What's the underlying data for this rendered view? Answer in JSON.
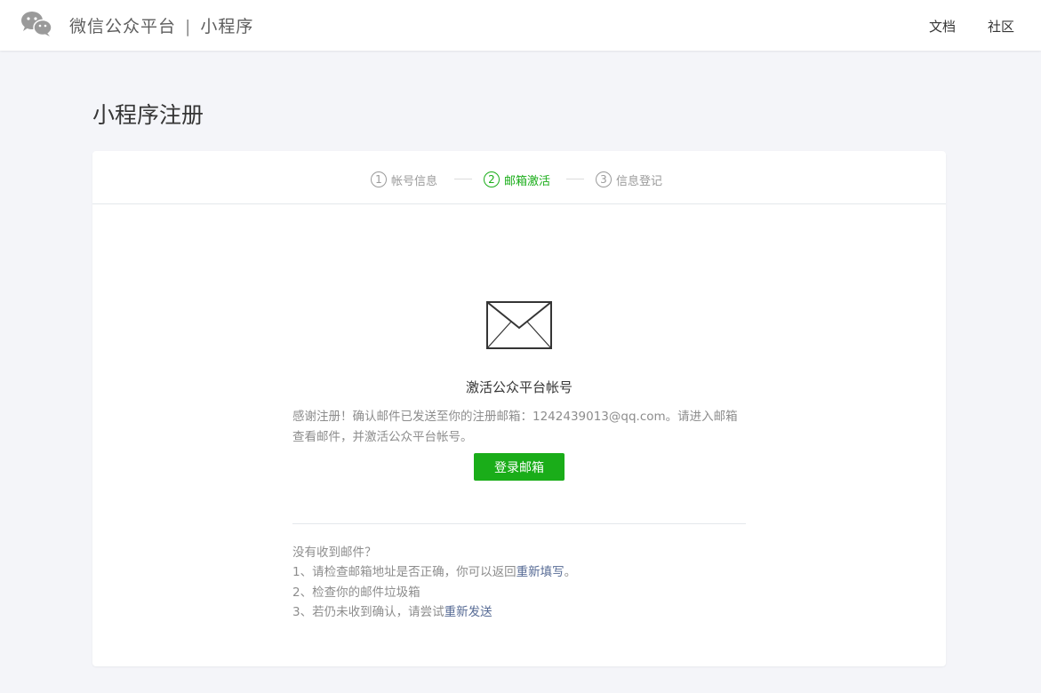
{
  "header": {
    "brand": "微信公众平台",
    "separator": "|",
    "product": "小程序",
    "nav": {
      "docs": "文档",
      "community": "社区"
    },
    "logo_icon": "wechat-logo-icon"
  },
  "page": {
    "title": "小程序注册"
  },
  "steps": [
    {
      "number": "1",
      "label": "帐号信息",
      "state": "done"
    },
    {
      "number": "2",
      "label": "邮箱激活",
      "state": "active"
    },
    {
      "number": "3",
      "label": "信息登记",
      "state": "pending"
    }
  ],
  "activation": {
    "icon": "envelope-icon",
    "title": "激活公众平台帐号",
    "description": "感谢注册！确认邮件已发送至你的注册邮箱：1242439013@qq.com。请进入邮箱查看邮件，并激活公众平台帐号。",
    "login_button": "登录邮箱"
  },
  "help": {
    "heading": "没有收到邮件？",
    "item1_prefix": "1、请检查邮箱地址是否正确，你可以返回",
    "item1_link": "重新填写",
    "item1_suffix": "。",
    "item2": "2、检查你的邮件垃圾箱",
    "item3_prefix": "3、若仍未收到确认，请尝试",
    "item3_link": "重新发送"
  },
  "colors": {
    "accent": "#1aad19",
    "link": "#576b95",
    "background": "#f4f5f9"
  }
}
